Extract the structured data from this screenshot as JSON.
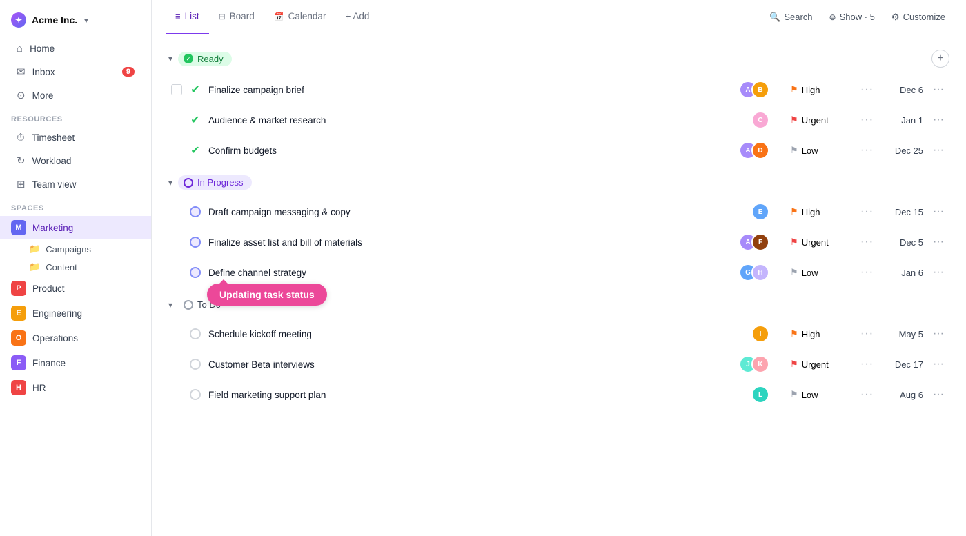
{
  "app": {
    "name": "Acme Inc.",
    "logo_letter": "✦"
  },
  "sidebar": {
    "nav": [
      {
        "id": "home",
        "label": "Home",
        "icon": "⌂"
      },
      {
        "id": "inbox",
        "label": "Inbox",
        "icon": "✉",
        "badge": "9"
      },
      {
        "id": "more",
        "label": "More",
        "icon": "⊙"
      }
    ],
    "resources_label": "Resources",
    "resources": [
      {
        "id": "timesheet",
        "label": "Timesheet",
        "icon": "⏱"
      },
      {
        "id": "workload",
        "label": "Workload",
        "icon": "↻"
      },
      {
        "id": "teamview",
        "label": "Team view",
        "icon": "⊞"
      }
    ],
    "spaces_label": "Spaces",
    "spaces": [
      {
        "id": "marketing",
        "label": "Marketing",
        "color": "#6366f1",
        "letter": "M",
        "active": true
      },
      {
        "id": "product",
        "label": "Product",
        "color": "#ef4444",
        "letter": "P"
      },
      {
        "id": "engineering",
        "label": "Engineering",
        "color": "#f59e0b",
        "letter": "E"
      },
      {
        "id": "operations",
        "label": "Operations",
        "color": "#f97316",
        "letter": "O"
      },
      {
        "id": "finance",
        "label": "Finance",
        "color": "#8b5cf6",
        "letter": "F"
      },
      {
        "id": "hr",
        "label": "HR",
        "color": "#ef4444",
        "letter": "H"
      }
    ],
    "sub_items": [
      {
        "id": "campaigns",
        "label": "Campaigns"
      },
      {
        "id": "content",
        "label": "Content"
      }
    ]
  },
  "tabs": [
    {
      "id": "list",
      "label": "List",
      "active": true
    },
    {
      "id": "board",
      "label": "Board"
    },
    {
      "id": "calendar",
      "label": "Calendar"
    },
    {
      "id": "add",
      "label": "+ Add"
    }
  ],
  "topbar_right": {
    "search": "Search",
    "show": "Show · 5",
    "customize": "Customize"
  },
  "groups": [
    {
      "id": "ready",
      "label": "Ready",
      "type": "ready",
      "tasks": [
        {
          "id": "t1",
          "name": "Finalize campaign brief",
          "avatars": [
            {
              "color": "#a78bfa",
              "letter": "A"
            },
            {
              "color": "#f59e0b",
              "letter": "B"
            }
          ],
          "priority": "High",
          "priority_color": "orange",
          "date": "Dec 6",
          "has_checkbox": true
        },
        {
          "id": "t2",
          "name": "Audience & market research",
          "avatars": [
            {
              "color": "#f9a8d4",
              "letter": "C"
            }
          ],
          "priority": "Urgent",
          "priority_color": "red",
          "date": "Jan 1",
          "has_checkbox": false
        },
        {
          "id": "t3",
          "name": "Confirm budgets",
          "avatars": [
            {
              "color": "#a78bfa",
              "letter": "A"
            },
            {
              "color": "#f97316",
              "letter": "D"
            }
          ],
          "priority": "Low",
          "priority_color": "gray",
          "date": "Dec 25",
          "has_checkbox": false
        }
      ]
    },
    {
      "id": "in-progress",
      "label": "In Progress",
      "type": "in-progress",
      "tasks": [
        {
          "id": "t4",
          "name": "Draft campaign messaging & copy",
          "avatars": [
            {
              "color": "#60a5fa",
              "letter": "E"
            }
          ],
          "priority": "High",
          "priority_color": "orange",
          "date": "Dec 15",
          "has_checkbox": false,
          "show_tooltip": false
        },
        {
          "id": "t5",
          "name": "Finalize asset list and bill of materials",
          "avatars": [
            {
              "color": "#a78bfa",
              "letter": "A"
            },
            {
              "color": "#92400e",
              "letter": "F"
            }
          ],
          "priority": "Urgent",
          "priority_color": "red",
          "date": "Dec 5",
          "has_checkbox": false
        },
        {
          "id": "t6",
          "name": "Define channel strategy",
          "avatars": [
            {
              "color": "#60a5fa",
              "letter": "G"
            },
            {
              "color": "#c4b5fd",
              "letter": "H"
            }
          ],
          "priority": "Low",
          "priority_color": "gray",
          "date": "Jan 6",
          "has_checkbox": false,
          "show_tooltip": true,
          "tooltip_text": "Updating task status"
        }
      ]
    },
    {
      "id": "todo",
      "label": "To Do",
      "type": "todo",
      "tasks": [
        {
          "id": "t7",
          "name": "Schedule kickoff meeting",
          "avatars": [
            {
              "color": "#f59e0b",
              "letter": "I"
            }
          ],
          "priority": "High",
          "priority_color": "orange",
          "date": "May 5",
          "has_checkbox": false
        },
        {
          "id": "t8",
          "name": "Customer Beta interviews",
          "avatars": [
            {
              "color": "#5eead4",
              "letter": "J"
            },
            {
              "color": "#fda4af",
              "letter": "K"
            }
          ],
          "priority": "Urgent",
          "priority_color": "red",
          "date": "Dec 17",
          "has_checkbox": false
        },
        {
          "id": "t9",
          "name": "Field marketing support plan",
          "avatars": [
            {
              "color": "#2dd4bf",
              "letter": "L"
            }
          ],
          "priority": "Low",
          "priority_color": "gray",
          "date": "Aug 6",
          "has_checkbox": false
        }
      ]
    }
  ]
}
